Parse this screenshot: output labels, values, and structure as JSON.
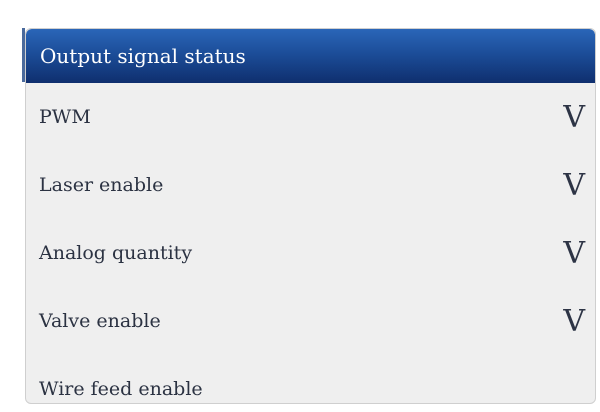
{
  "panel": {
    "title": "Output signal status",
    "rows": [
      {
        "label": "PWM",
        "value": "V"
      },
      {
        "label": "Laser enable",
        "value": "V"
      },
      {
        "label": "Analog quantity",
        "value": "V"
      },
      {
        "label": "Valve enable",
        "value": "V"
      },
      {
        "label": "Wire feed enable",
        "value": ""
      }
    ]
  }
}
